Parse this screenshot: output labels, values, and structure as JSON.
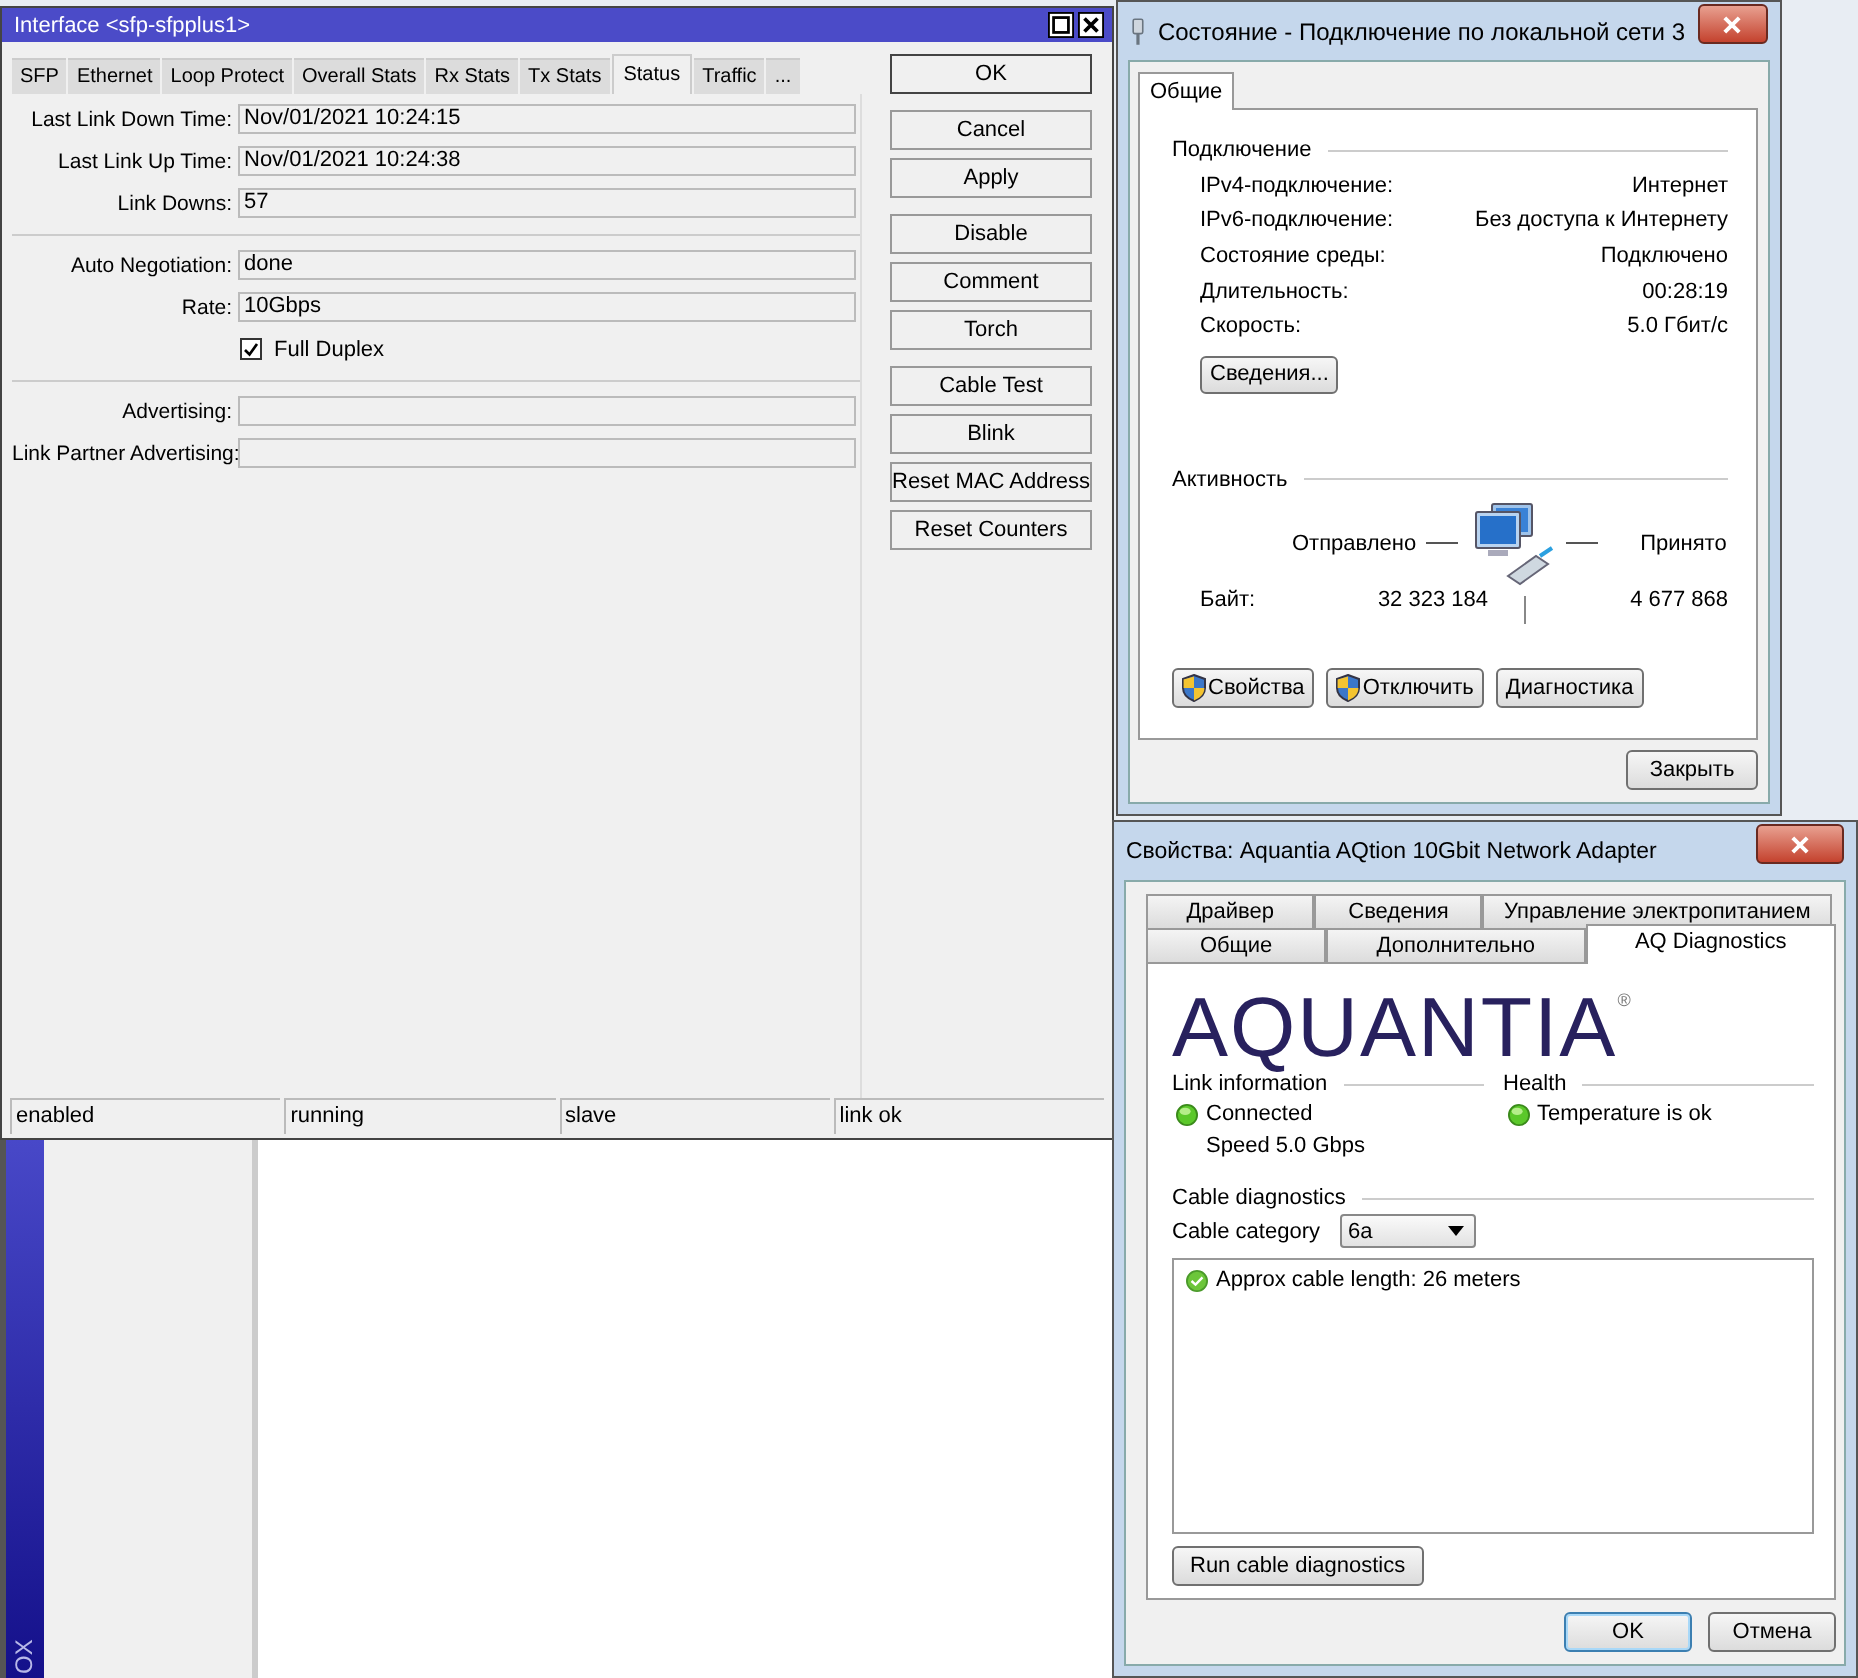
{
  "interface_window": {
    "title": "Interface <sfp-sfpplus1>",
    "tabs": [
      {
        "label": "SFP",
        "selected": false
      },
      {
        "label": "Ethernet",
        "selected": false
      },
      {
        "label": "Loop Protect",
        "selected": false
      },
      {
        "label": "Overall Stats",
        "selected": false
      },
      {
        "label": "Rx Stats",
        "selected": false
      },
      {
        "label": "Tx Stats",
        "selected": false
      },
      {
        "label": "Status",
        "selected": true
      },
      {
        "label": "Traffic",
        "selected": false
      },
      {
        "label": "...",
        "selected": false
      }
    ],
    "sections": [
      {
        "rows": [
          {
            "kind": "field",
            "label": "Last Link Down Time:",
            "value": "Nov/01/2021 10:24:15"
          },
          {
            "kind": "field",
            "label": "Last Link Up Time:",
            "value": "Nov/01/2021 10:24:38"
          },
          {
            "kind": "field",
            "label": "Link Downs:",
            "value": "57"
          }
        ]
      },
      {
        "rows": [
          {
            "kind": "field",
            "label": "Auto Negotiation:",
            "value": "done"
          },
          {
            "kind": "field",
            "label": "Rate:",
            "value": "10Gbps"
          },
          {
            "kind": "checkbox",
            "label": "Full Duplex",
            "checked": true
          }
        ]
      },
      {
        "rows": [
          {
            "kind": "field",
            "label": "Advertising:"
          },
          {
            "kind": "field",
            "label": "Link Partner Advertising:"
          }
        ]
      }
    ],
    "button_groups": [
      [
        "OK"
      ],
      [
        "Cancel",
        "Apply"
      ],
      [
        "Disable",
        "Comment",
        "Torch"
      ],
      [
        "Cable Test",
        "Blink",
        "Reset MAC Address",
        "Reset Counters"
      ]
    ],
    "status_bar": [
      "enabled",
      "running",
      "slave",
      "link ok"
    ]
  },
  "winbox": {
    "sidebar_label": "OX"
  },
  "status_dialog": {
    "title": "Состояние - Подключение по локальной сети 3",
    "tabs": [
      {
        "label": "Общие",
        "selected": true
      }
    ],
    "connection": {
      "heading": "Подключение",
      "rows": [
        {
          "label": "IPv4-подключение:",
          "value": "Интернет"
        },
        {
          "label": "IPv6-подключение:",
          "value": "Без доступа к Интернету"
        },
        {
          "label": "Состояние среды:",
          "value": "Подключено"
        },
        {
          "label": "Длительность:",
          "value": "00:28:19"
        },
        {
          "label": "Скорость:",
          "value": "5.0 Гбит/с"
        }
      ]
    },
    "details_button": "Сведения...",
    "activity": {
      "heading": "Активность",
      "sent_label": "Отправлено",
      "received_label": "Принято",
      "bytes_label": "Байт:",
      "sent": "32 323 184",
      "received": "4 677 868"
    },
    "buttons": [
      {
        "label": "Свойства",
        "shield": true
      },
      {
        "label": "Отключить",
        "shield": true
      },
      {
        "label": "Диагностика",
        "shield": false
      }
    ],
    "close_button": "Закрыть"
  },
  "adapter_dialog": {
    "title": "Свойства: Aquantia AQtion 10Gbit Network Adapter",
    "tab_rows": [
      [
        {
          "label": "Драйвер",
          "selected": false
        },
        {
          "label": "Сведения",
          "selected": false
        },
        {
          "label": "Управление электропитанием",
          "selected": false
        }
      ],
      [
        {
          "label": "Общие",
          "selected": false
        },
        {
          "label": "Дополнительно",
          "selected": false
        },
        {
          "label": "AQ Diagnostics",
          "selected": true
        }
      ]
    ],
    "logo": "AQUANTIA",
    "logo_mark": "®",
    "link": {
      "heading": "Link information",
      "status": "Connected",
      "speed": "Speed 5.0 Gbps"
    },
    "health": {
      "heading": "Health",
      "status": "Temperature is ok"
    },
    "cable": {
      "heading": "Cable diagnostics",
      "category_label": "Cable category",
      "category_value": "6a",
      "results": [
        "Approx cable length: 26 meters"
      ],
      "run_button": "Run cable diagnostics"
    },
    "buttons": [
      "OK",
      "Отмена"
    ]
  }
}
